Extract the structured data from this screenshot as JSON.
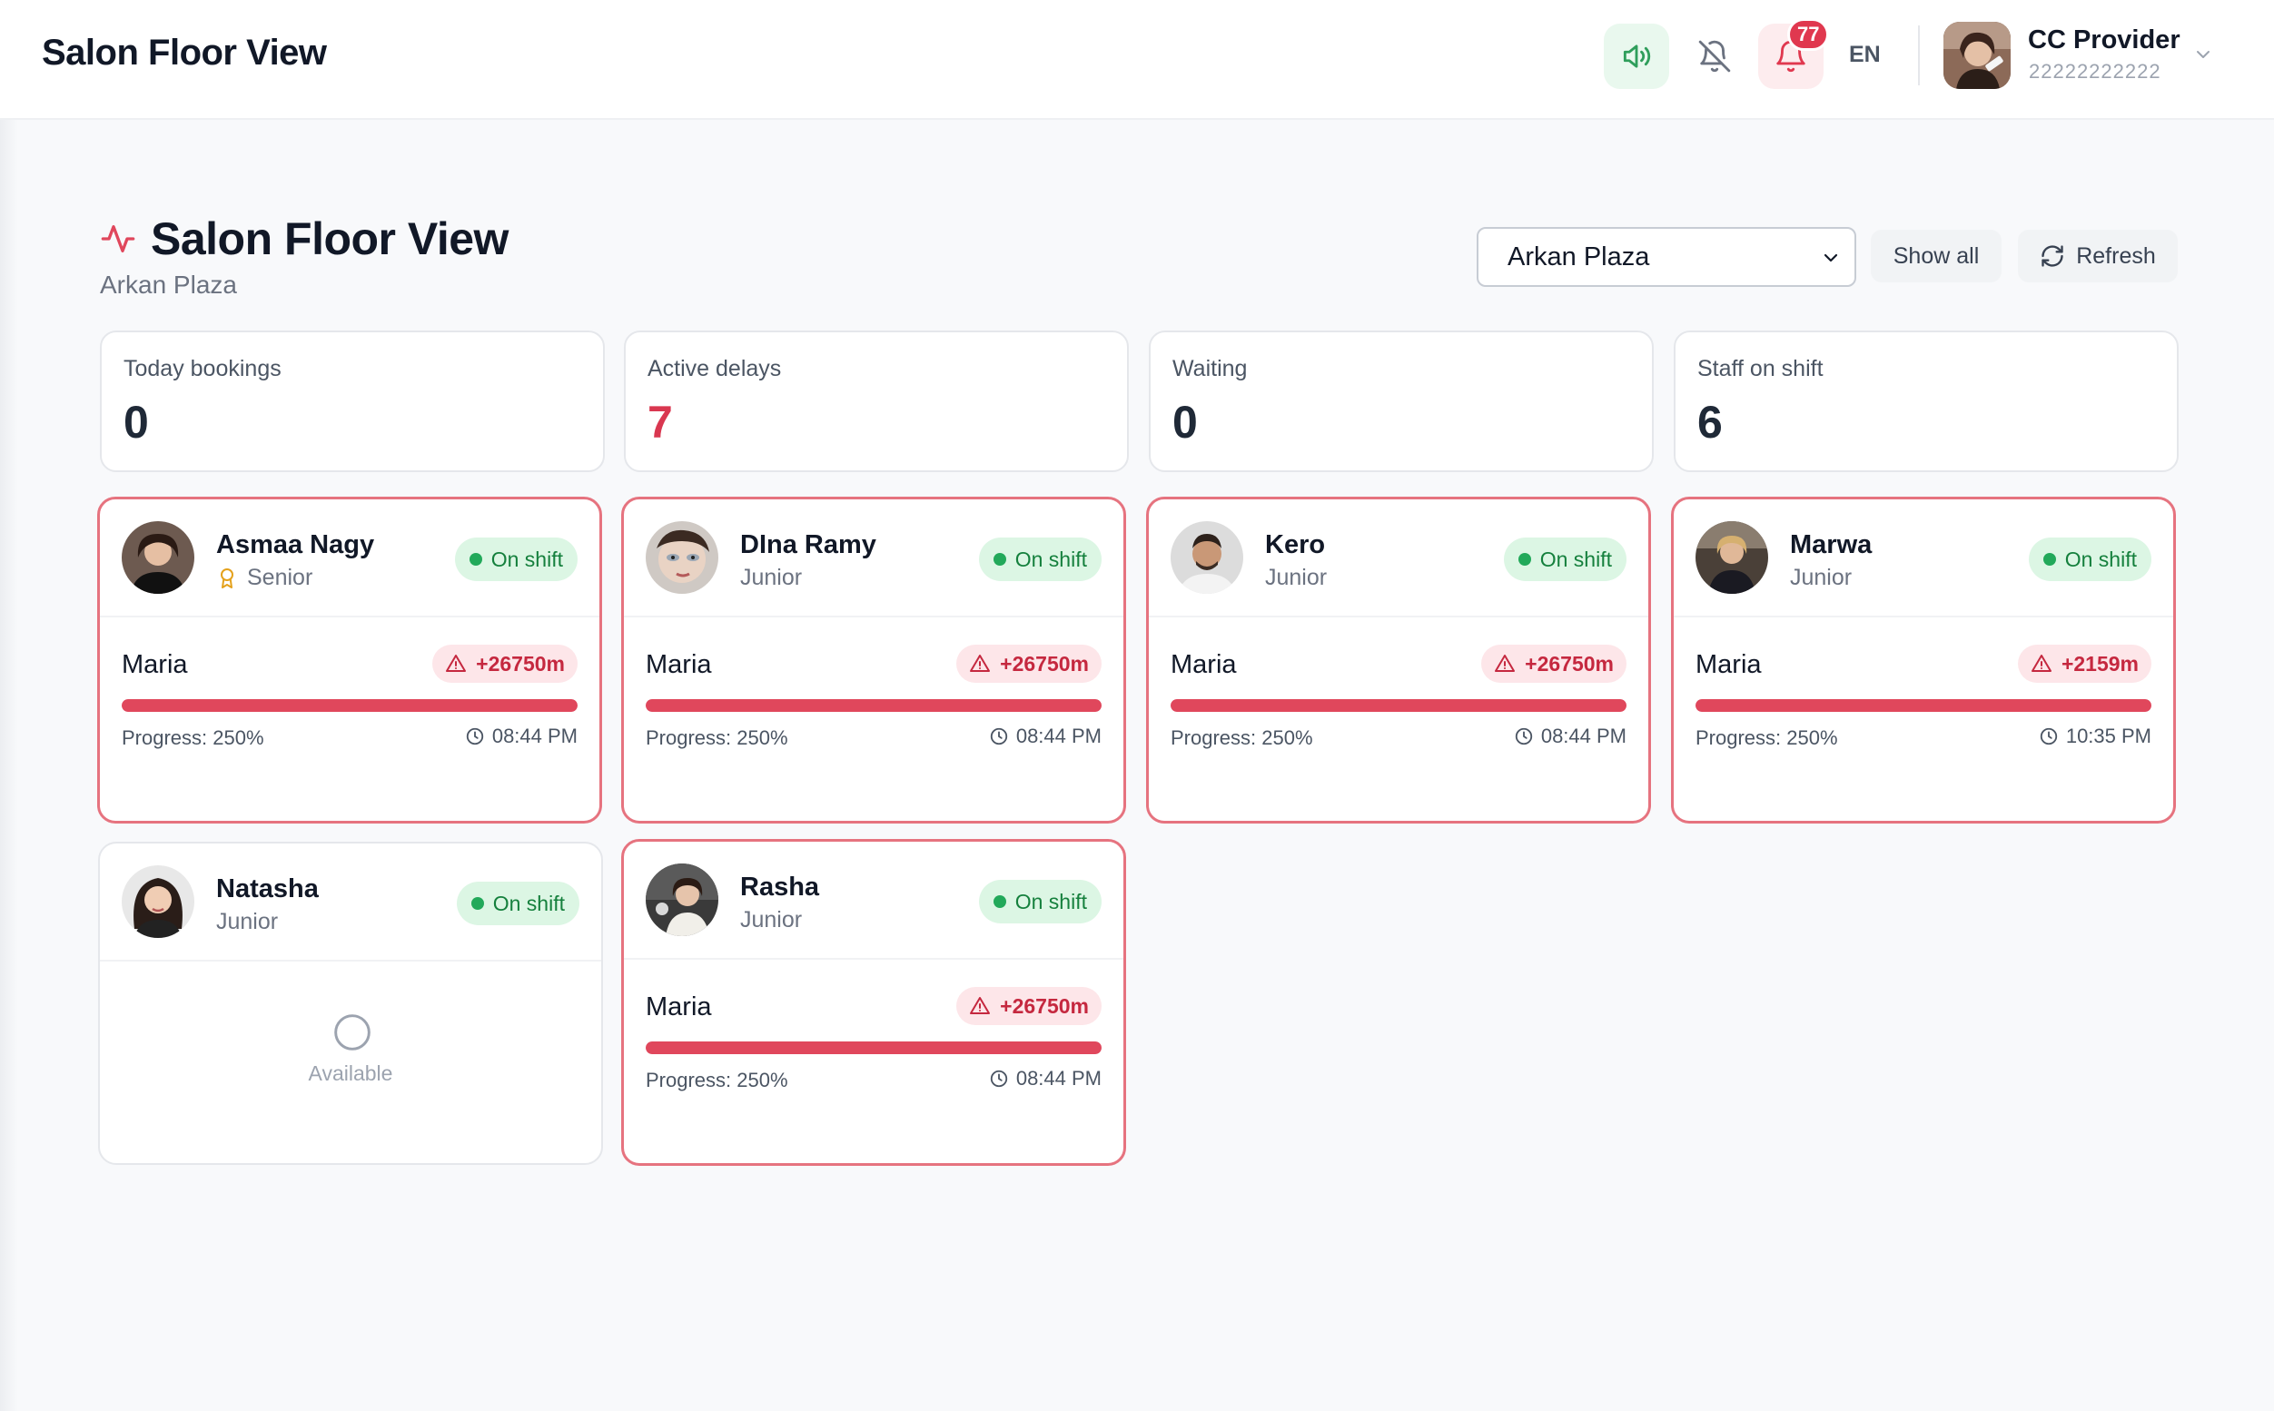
{
  "header": {
    "app_title": "Salon Floor View",
    "notification_count": "77",
    "language": "EN",
    "user": {
      "name": "CC Provider",
      "phone": "22222222222"
    }
  },
  "page": {
    "title": "Salon Floor View",
    "subtitle": "Arkan Plaza",
    "branch_select": {
      "value": "Arkan Plaza"
    },
    "show_all_label": "Show all",
    "refresh_label": "Refresh"
  },
  "stats": [
    {
      "label": "Today bookings",
      "value": "0"
    },
    {
      "label": "Active delays",
      "value": "7"
    },
    {
      "label": "Waiting",
      "value": "0"
    },
    {
      "label": "Staff on shift",
      "value": "6"
    }
  ],
  "staff": [
    {
      "name": "Asmaa Nagy",
      "level": "Senior",
      "shift": "On shift",
      "client": "Maria",
      "delay": "+26750m",
      "progress_label": "Progress: 250%",
      "progress": 250,
      "time": "08:44 PM"
    },
    {
      "name": "DIna Ramy",
      "level": "Junior",
      "shift": "On shift",
      "client": "Maria",
      "delay": "+26750m",
      "progress_label": "Progress: 250%",
      "progress": 250,
      "time": "08:44 PM"
    },
    {
      "name": "Kero",
      "level": "Junior",
      "shift": "On shift",
      "client": "Maria",
      "delay": "+26750m",
      "progress_label": "Progress: 250%",
      "progress": 250,
      "time": "08:44 PM"
    },
    {
      "name": "Marwa",
      "level": "Junior",
      "shift": "On shift",
      "client": "Maria",
      "delay": "+2159m",
      "progress_label": "Progress: 250%",
      "progress": 250,
      "time": "10:35 PM"
    },
    {
      "name": "Natasha",
      "level": "Junior",
      "shift": "On shift",
      "available_label": "Available"
    },
    {
      "name": "Rasha",
      "level": "Junior",
      "shift": "On shift",
      "client": "Maria",
      "delay": "+26750m",
      "progress_label": "Progress: 250%",
      "progress": 250,
      "time": "08:44 PM"
    }
  ],
  "colors": {
    "accent_red": "#e0475c",
    "shift_green": "#15803d",
    "sound_bg": "#e9f8ee",
    "notif_bg": "#fdecee"
  }
}
